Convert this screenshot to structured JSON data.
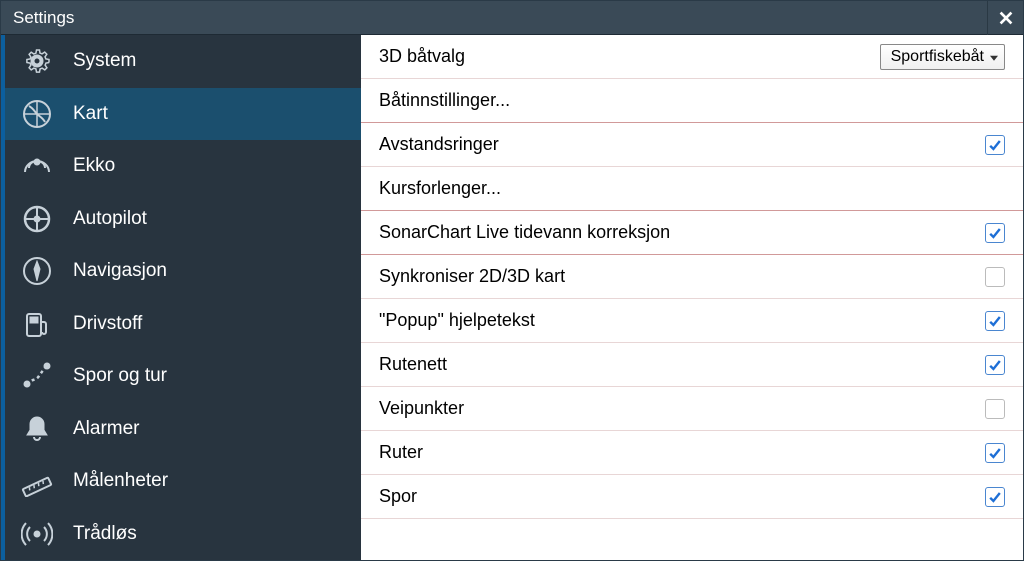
{
  "window": {
    "title": "Settings"
  },
  "sidebar": {
    "items": [
      {
        "id": "system",
        "label": "System",
        "icon": "gear",
        "selected": false
      },
      {
        "id": "kart",
        "label": "Kart",
        "icon": "chart",
        "selected": true
      },
      {
        "id": "ekko",
        "label": "Ekko",
        "icon": "sonar",
        "selected": false
      },
      {
        "id": "autopilot",
        "label": "Autopilot",
        "icon": "wheel",
        "selected": false
      },
      {
        "id": "navigasjon",
        "label": "Navigasjon",
        "icon": "compass",
        "selected": false
      },
      {
        "id": "drivstoff",
        "label": "Drivstoff",
        "icon": "fuel",
        "selected": false
      },
      {
        "id": "spor",
        "label": "Spor og tur",
        "icon": "track",
        "selected": false
      },
      {
        "id": "alarmer",
        "label": "Alarmer",
        "icon": "bell",
        "selected": false
      },
      {
        "id": "malenheter",
        "label": "Målenheter",
        "icon": "ruler",
        "selected": false
      },
      {
        "id": "tradlos",
        "label": "Trådløs",
        "icon": "wireless",
        "selected": false
      }
    ]
  },
  "settings": {
    "items": [
      {
        "id": "boat3d",
        "label": "3D båtvalg",
        "type": "dropdown",
        "value": "Sportfiskebåt",
        "divider": false
      },
      {
        "id": "boatsettings",
        "label": "Båtinnstillinger...",
        "type": "link",
        "divider": true
      },
      {
        "id": "rangerings",
        "label": "Avstandsringer",
        "type": "checkbox",
        "checked": true,
        "divider": false
      },
      {
        "id": "courseext",
        "label": "Kursforlenger...",
        "type": "link",
        "divider": true
      },
      {
        "id": "sonartide",
        "label": "SonarChart Live tidevann korreksjon",
        "type": "checkbox",
        "checked": true,
        "divider": true
      },
      {
        "id": "sync2d3d",
        "label": "Synkroniser 2D/3D kart",
        "type": "checkbox",
        "checked": false,
        "divider": false
      },
      {
        "id": "popup",
        "label": "\"Popup\" hjelpetekst",
        "type": "checkbox",
        "checked": true,
        "divider": false
      },
      {
        "id": "rutenett",
        "label": "Rutenett",
        "type": "checkbox",
        "checked": true,
        "divider": false
      },
      {
        "id": "veipunkter",
        "label": "Veipunkter",
        "type": "checkbox",
        "checked": false,
        "divider": false
      },
      {
        "id": "ruter",
        "label": "Ruter",
        "type": "checkbox",
        "checked": true,
        "divider": false
      },
      {
        "id": "spor",
        "label": "Spor",
        "type": "checkbox",
        "checked": true,
        "divider": false
      }
    ]
  }
}
